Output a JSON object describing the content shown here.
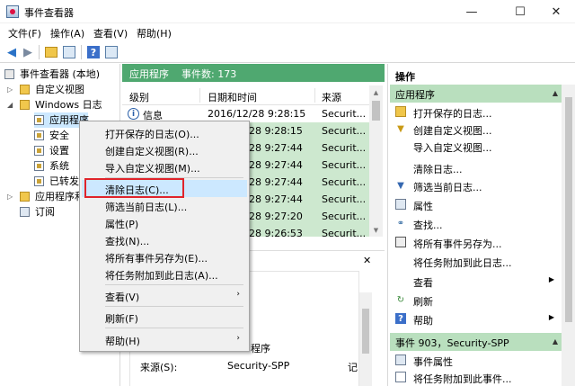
{
  "window": {
    "title": "事件查看器",
    "min": "—",
    "max": "☐",
    "close": "✕"
  },
  "menubar": [
    "文件(F)",
    "操作(A)",
    "查看(V)",
    "帮助(H)"
  ],
  "tree": {
    "root": "事件查看器 (本地)",
    "custom_views": "自定义视图",
    "windows_logs": "Windows 日志",
    "items": [
      "应用程序",
      "安全",
      "设置",
      "系统",
      "已转发"
    ],
    "app_service_logs": "应用程序和",
    "subscriptions": "订阅"
  },
  "center": {
    "header_title": "应用程序",
    "header_count": "事件数: 173",
    "columns": [
      "级别",
      "日期和时间",
      "来源"
    ],
    "rows": [
      {
        "level": "信息",
        "datetime": "2016/12/28 9:28:15",
        "source": "Securit..."
      },
      {
        "level": "",
        "datetime": "28 9:28:15",
        "source": "Securit..."
      },
      {
        "level": "",
        "datetime": "28 9:27:44",
        "source": "Securit..."
      },
      {
        "level": "",
        "datetime": "28 9:27:44",
        "source": "Securit..."
      },
      {
        "level": "",
        "datetime": "28 9:27:44",
        "source": "Securit..."
      },
      {
        "level": "",
        "datetime": "28 9:27:44",
        "source": "Securit..."
      },
      {
        "level": "",
        "datetime": "28 9:27:20",
        "source": "Securit..."
      },
      {
        "level": "",
        "datetime": "28 9:26:53",
        "source": "Securit..."
      }
    ],
    "detail": {
      "close": "✕",
      "fragment": "程序",
      "source_label": "来源(S):",
      "source_value": "Security-SPP",
      "cut_text": "记"
    }
  },
  "context_menu": {
    "items": [
      {
        "label": "打开保存的日志(O)..."
      },
      {
        "label": "创建自定义视图(R)..."
      },
      {
        "label": "导入自定义视图(M)..."
      },
      {
        "label": "清除日志(C)..."
      },
      {
        "label": "筛选当前日志(L)..."
      },
      {
        "label": "属性(P)"
      },
      {
        "label": "查找(N)..."
      },
      {
        "label": "将所有事件另存为(E)..."
      },
      {
        "label": "将任务附加到此日志(A)..."
      },
      {
        "label": "查看(V)"
      },
      {
        "label": "刷新(F)"
      },
      {
        "label": "帮助(H)"
      }
    ]
  },
  "actions": {
    "header": "操作",
    "section1": "应用程序",
    "items1": [
      "打开保存的日志...",
      "创建自定义视图...",
      "导入自定义视图...",
      "清除日志...",
      "筛选当前日志...",
      "属性",
      "查找...",
      "将所有事件另存为...",
      "将任务附加到此日志...",
      "查看",
      "刷新",
      "帮助"
    ],
    "section2": "事件 903，Security-SPP",
    "items2": [
      "事件属性",
      "将任务附加到此事件..."
    ]
  }
}
